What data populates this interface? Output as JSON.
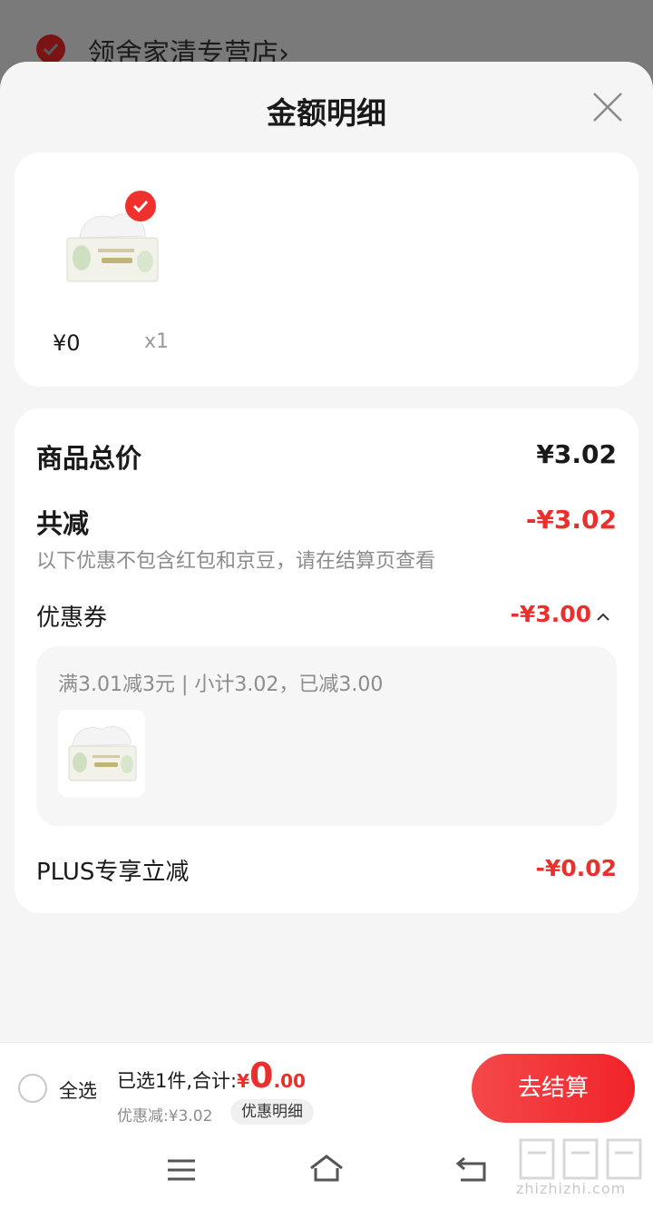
{
  "background": {
    "shop_name": "领舍家清专营店",
    "shop_chevron": "›"
  },
  "sheet": {
    "title": "金额明细",
    "close_icon": "close-icon"
  },
  "goods": {
    "price": "¥0",
    "quantity": "x1",
    "checked": true
  },
  "detail": {
    "total_label": "商品总价",
    "total_value": "¥3.02",
    "reduce_label": "共减",
    "reduce_value": "-¥3.02",
    "reduce_note": "以下优惠不包含红包和京豆，请在结算页查看",
    "coupon_label": "优惠券",
    "coupon_value": "-¥3.00",
    "coupon_rule": "满3.01减3元 | 小计3.02，已减3.00",
    "plus_label": "PLUS专享立减",
    "plus_value": "-¥0.02"
  },
  "bottom_bar": {
    "select_all": "全选",
    "selected_text": "已选1件,合计:",
    "sum_currency": "¥",
    "sum_integer": "0",
    "sum_decimal": ".00",
    "discount_text": "优惠减:¥3.02",
    "detail_chip": "优惠明细",
    "checkout": "去结算"
  },
  "watermark": {
    "text": "zhizhizhi.com"
  },
  "colors": {
    "accent_red": "#e8302d",
    "checkout_red": "#f0242a",
    "sheet_bg": "#f5f5f5"
  }
}
